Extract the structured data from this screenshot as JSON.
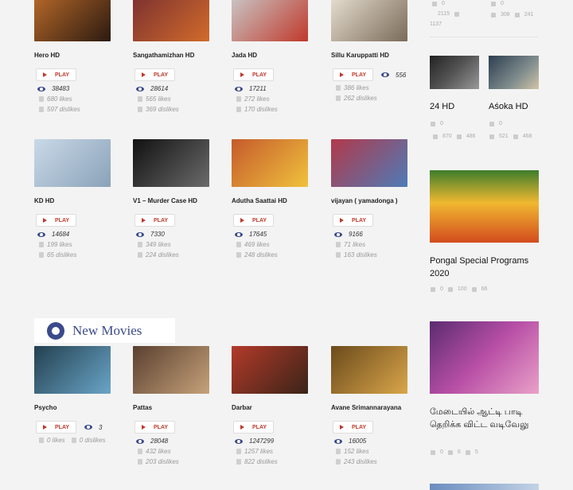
{
  "grid": [
    {
      "title": "Hero HD",
      "play": "PLAY",
      "views": "38483",
      "likes": "680 likes",
      "dislikes": "597 dislikes",
      "colors": [
        "#b8692a",
        "#2b1a10"
      ]
    },
    {
      "title": "Sangathamizhan HD",
      "play": "PLAY",
      "views": "28614",
      "likes": "565 likes",
      "dislikes": "369 dislikes",
      "colors": [
        "#7a3030",
        "#d26b2b"
      ]
    },
    {
      "title": "Jada HD",
      "play": "PLAY",
      "views": "17211",
      "likes": "272 likes",
      "dislikes": "170 dislikes",
      "colors": [
        "#c9c9c9",
        "#c0392b"
      ]
    },
    {
      "title": "Sillu Karuppatti HD",
      "play": "PLAY",
      "views": "556",
      "likes": "386 likes",
      "dislikes": "262 dislikes",
      "colors": [
        "#e9e1d4",
        "#7a6b58"
      ]
    },
    {
      "title": "KD HD",
      "play": "PLAY",
      "views": "14684",
      "likes": "199 likes",
      "dislikes": "65 dislikes",
      "colors": [
        "#c9d9e8",
        "#8aa2b8"
      ]
    },
    {
      "title": "V1 – Murder Case HD",
      "play": "PLAY",
      "views": "7330",
      "likes": "349 likes",
      "dislikes": "224 dislikes",
      "colors": [
        "#111111",
        "#6b6b6b"
      ]
    },
    {
      "title": "Adutha Saattai HD",
      "play": "PLAY",
      "views": "17645",
      "likes": "469 likes",
      "dislikes": "248 dislikes",
      "colors": [
        "#c55a2c",
        "#f0c23c"
      ]
    },
    {
      "title": "vijayan ( yamadonga )",
      "play": "PLAY",
      "views": "9166",
      "likes": "71 likes",
      "dislikes": "163 dislikes",
      "colors": [
        "#b2394a",
        "#4d7bb8"
      ]
    },
    {
      "title": "Psycho",
      "play": "PLAY",
      "views": "3",
      "likes": "0 likes",
      "dislikes": "0 dislikes",
      "colors": [
        "#23404f",
        "#6aa5c8"
      ]
    },
    {
      "title": "Pattas",
      "play": "PLAY",
      "views": "28048",
      "likes": "432 likes",
      "dislikes": "203 dislikes",
      "colors": [
        "#5a4030",
        "#c6a27a"
      ]
    },
    {
      "title": "Darbar",
      "play": "PLAY",
      "views": "1247299",
      "likes": "1257 likes",
      "dislikes": "822 dislikes",
      "colors": [
        "#b33a2a",
        "#3a2418"
      ]
    },
    {
      "title": "Avane Srimannarayana",
      "play": "PLAY",
      "views": "16005",
      "likes": "152 likes",
      "dislikes": "243 dislikes",
      "colors": [
        "#6b4a1c",
        "#d9a64a"
      ]
    }
  ],
  "banner": {
    "text": "New Movies"
  },
  "sidebar": {
    "top": {
      "a_count": "0",
      "a_likes": "2115",
      "a_dis": "1137",
      "b_count": "0",
      "b_likes": "308",
      "b_dis": "241"
    },
    "items": [
      {
        "title": "24 HD",
        "count": "0",
        "likes": "870",
        "dislikes": "486"
      },
      {
        "title": "Aśoka HD",
        "count": "0",
        "likes": "521",
        "dislikes": "468"
      },
      {
        "title": "Pongal Special Programs 2020",
        "count": "0",
        "likes": "100",
        "dislikes": "66"
      },
      {
        "title": "மேடையில் ஆட்டி பாடி தெறிக்க விட்ட வடிவேலு",
        "count": "0",
        "likes": "6",
        "dislikes": "5"
      }
    ]
  }
}
